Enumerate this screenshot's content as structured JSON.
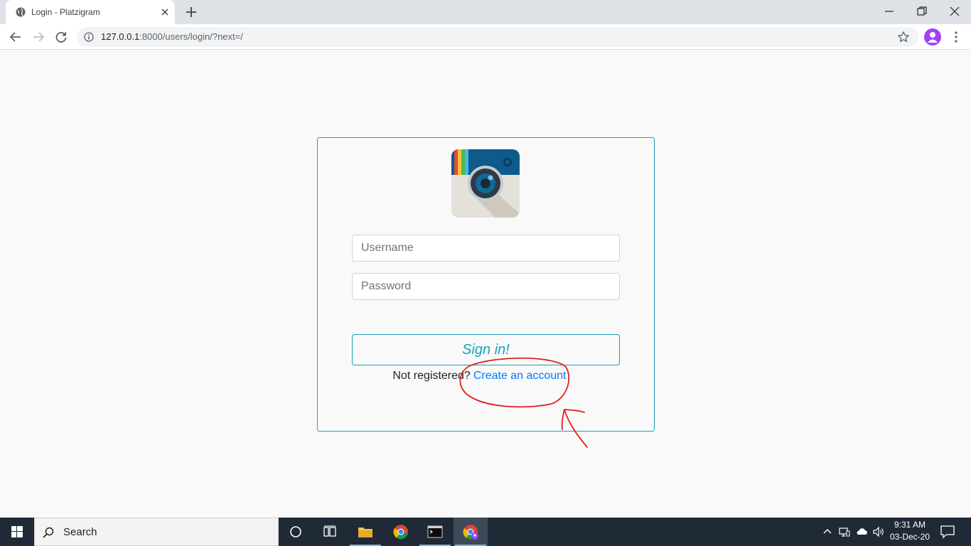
{
  "browser": {
    "tab_title": "Login - Platzigram",
    "url_host": "127.0.0.1",
    "url_rest": ":8000/users/login/?next=/"
  },
  "login": {
    "username_placeholder": "Username",
    "password_placeholder": "Password",
    "signin_label": "Sign in!",
    "not_registered_text": "Not registered?",
    "create_account_link": "Create an account"
  },
  "taskbar": {
    "search_placeholder": "Search",
    "time": "9:31 AM",
    "date": "03-Dec-20"
  },
  "colors": {
    "accent": "#17a2b8",
    "link": "#007bff",
    "annotation": "#e0201a"
  }
}
